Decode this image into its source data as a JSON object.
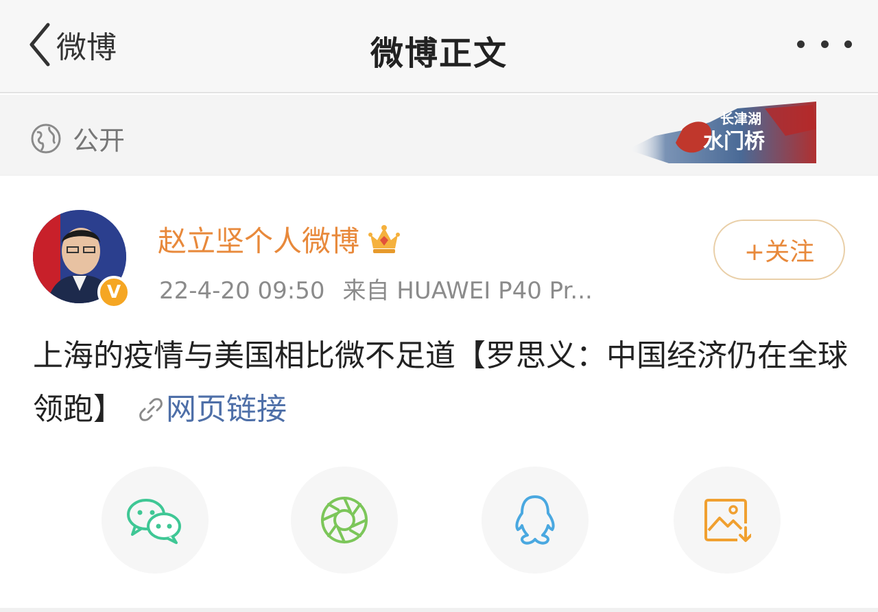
{
  "nav": {
    "back_label": "微博",
    "title": "微博正文"
  },
  "visibility": {
    "label": "公开"
  },
  "banner": {
    "top_text": "长津湖",
    "bottom_text": "水门桥"
  },
  "post": {
    "username": "赵立坚个人微博",
    "timestamp": "22-4-20 09:50",
    "source": "来自 HUAWEI P40 Pr...",
    "follow_label": "+关注",
    "verified_badge": "V",
    "content_text": "上海的疫情与美国相比微不足道【罗思义：中国经济仍在全球领跑】",
    "link_text": "网页链接"
  },
  "share_icons": [
    "wechat-icon",
    "moments-icon",
    "qq-icon",
    "save-image-icon"
  ],
  "colors": {
    "username": "#e8893b",
    "follow_border": "#e9cfa8",
    "link": "#4e6fa8",
    "wechat": "#3fc795",
    "moments": "#7cc65a",
    "qq": "#4aa8e0",
    "save": "#f0a030"
  }
}
